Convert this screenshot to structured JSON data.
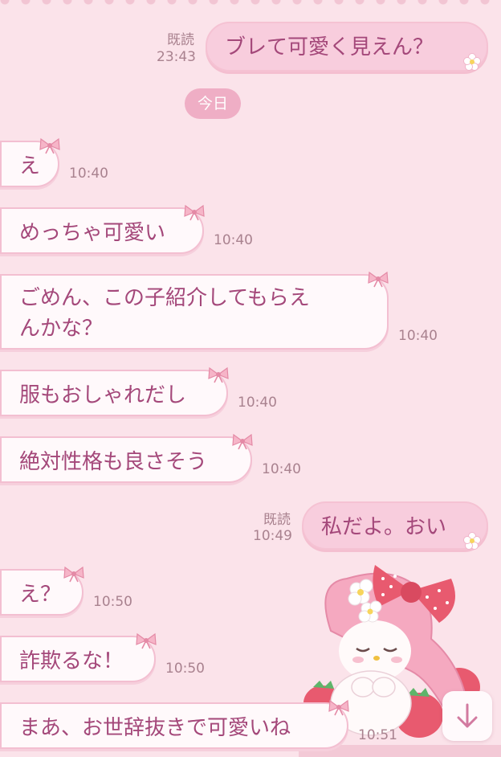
{
  "chat": {
    "date_separator": "今日",
    "messages": [
      {
        "side": "out",
        "text": "ブレて可愛く見えん？",
        "read": "既読",
        "time": "23:43"
      },
      {
        "side": "in",
        "text": "え",
        "time": "10:40"
      },
      {
        "side": "in",
        "text": "めっちゃ可愛い",
        "time": "10:40"
      },
      {
        "side": "in",
        "text_line1": "ごめん、この子紹介してもらえ",
        "text_line2": "んかな？",
        "time": "10:40"
      },
      {
        "side": "in",
        "text": "服もおしゃれだし",
        "time": "10:40"
      },
      {
        "side": "in",
        "text": "絶対性格も良さそう",
        "time": "10:40"
      },
      {
        "side": "out",
        "text": "私だよ。おい",
        "read": "既読",
        "time": "10:49"
      },
      {
        "side": "in",
        "text": "え？",
        "time": "10:50"
      },
      {
        "side": "in",
        "text": "詐欺るな！",
        "time": "10:50"
      },
      {
        "side": "in",
        "text": "まあ、お世辞抜きで可愛いね",
        "time": "10:51"
      }
    ]
  },
  "icons": {
    "bow": "ribbon-bow-icon",
    "flower": "flower-icon",
    "scroll": "arrow-down-icon",
    "character": "my-melody-sticker"
  },
  "colors": {
    "background": "#fbe3ea",
    "text": "#a4487a",
    "incoming_bubble": "#fff9fb",
    "outgoing_bubble": "#f8cddd",
    "bubble_border": "#f3bfd1",
    "date_pill": "#efaec5",
    "meta_text": "#a9828f"
  }
}
